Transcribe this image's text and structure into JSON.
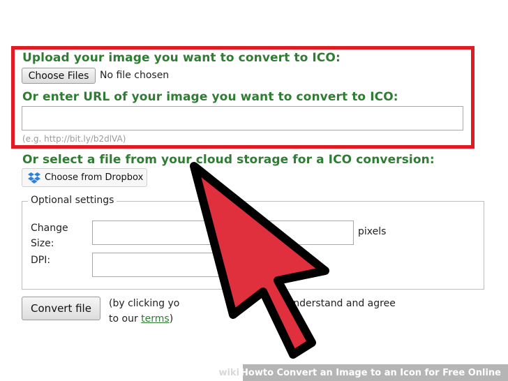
{
  "upload": {
    "heading": "Upload your image you want to convert to ICO:",
    "choose_button": "Choose Files",
    "file_status": "No file chosen"
  },
  "url": {
    "heading": "Or enter URL of your image you want to convert to ICO:",
    "value": "",
    "hint": "(e.g. http://bit.ly/b2dlVA)"
  },
  "cloud": {
    "heading": "Or select a file from your cloud storage for a ICO conversion:",
    "dropbox_button": "Choose from Dropbox"
  },
  "settings": {
    "legend": "Optional settings",
    "change_size_label": "Change Size:",
    "size_unit": "pixels",
    "dpi_label": "DPI:"
  },
  "convert": {
    "button": "Convert file",
    "terms_prefix": "(by clicking yo",
    "terms_middle": "u understand and agree",
    "terms_line2_prefix": "to our",
    "terms_link": "terms",
    "terms_suffix": ")"
  },
  "caption": {
    "wiki": "wiki",
    "how": "How",
    "title": " to Convert an Image to an Icon for Free Online"
  },
  "colors": {
    "heading_green": "#2e7d32",
    "highlight_red": "#e01b24",
    "arrow_red": "#e0303e",
    "dropbox_blue": "#2f7fe0"
  }
}
